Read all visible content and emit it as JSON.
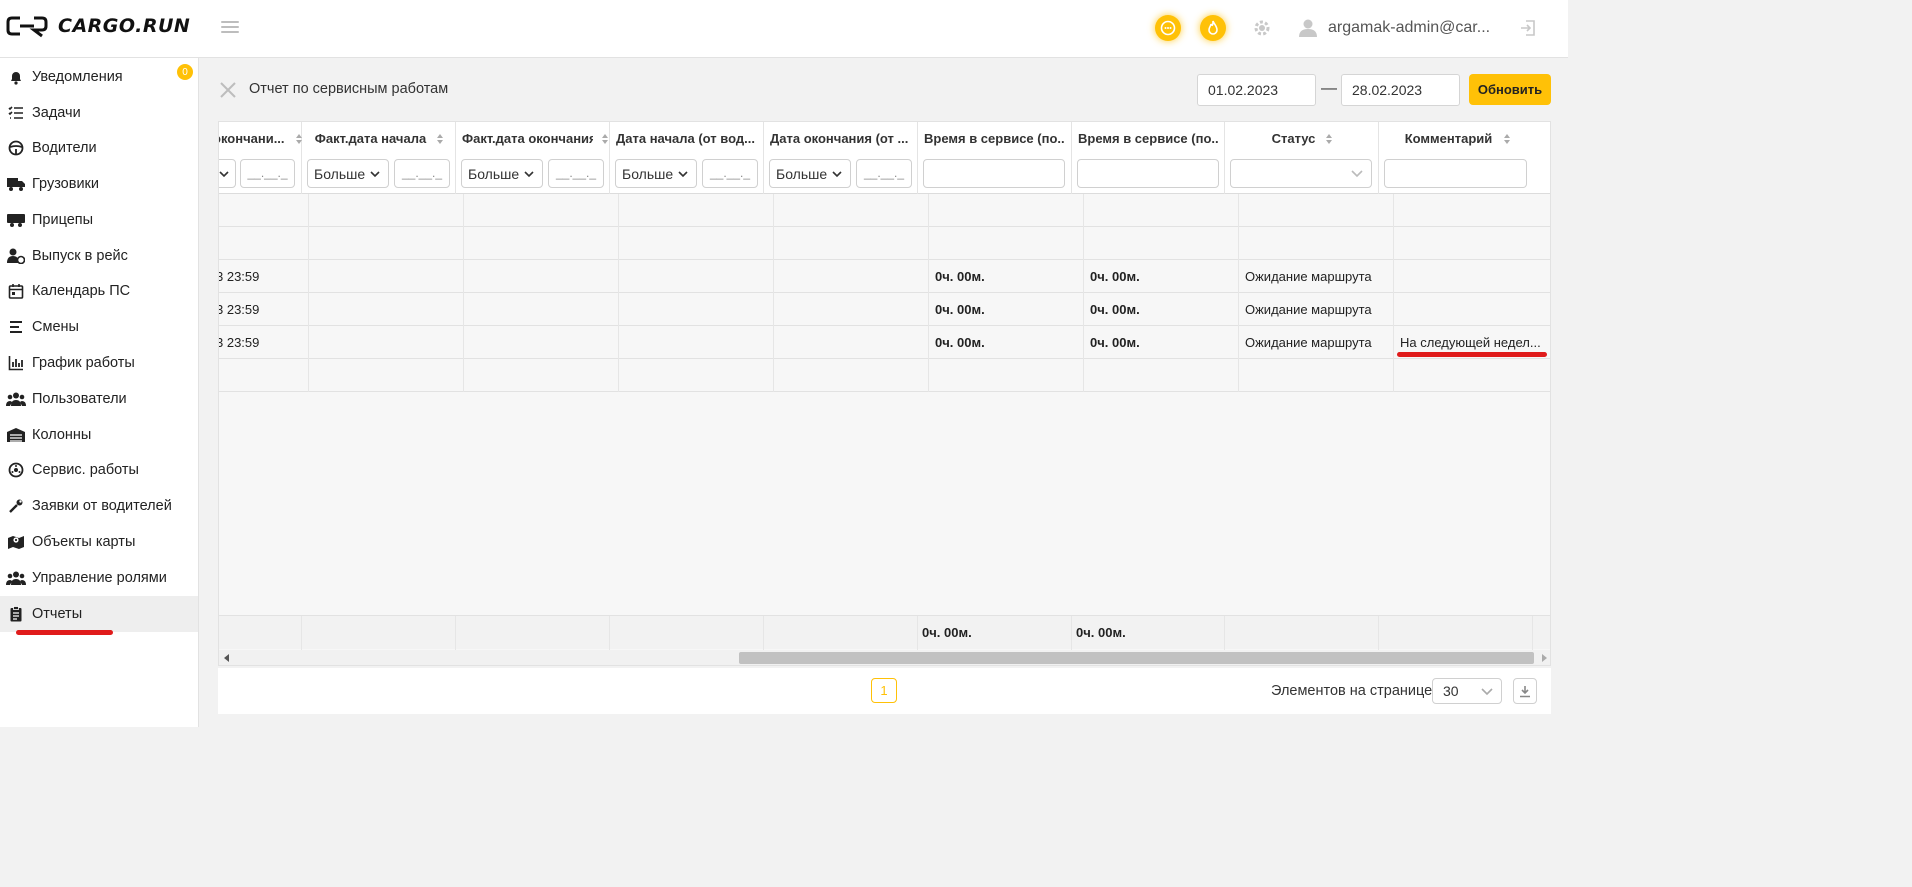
{
  "header": {
    "logo_text": "CARGO.RUN",
    "user_name": "argamak-admin@car...",
    "accent_color": "#ffc107"
  },
  "sidebar": {
    "items": [
      {
        "label": "Уведомления",
        "icon": "bell-icon",
        "badge": "0"
      },
      {
        "label": "Задачи",
        "icon": "task-list-icon"
      },
      {
        "label": "Водители",
        "icon": "steering-wheel-icon"
      },
      {
        "label": "Грузовики",
        "icon": "truck-icon"
      },
      {
        "label": "Прицепы",
        "icon": "trailer-icon"
      },
      {
        "label": "Выпуск в рейс",
        "icon": "user-check-icon"
      },
      {
        "label": "Календарь ПС",
        "icon": "calendar-icon"
      },
      {
        "label": "Смены",
        "icon": "shifts-icon"
      },
      {
        "label": "График работы",
        "icon": "chart-icon"
      },
      {
        "label": "Пользователи",
        "icon": "users-icon"
      },
      {
        "label": "Колонны",
        "icon": "warehouse-icon"
      },
      {
        "label": "Сервис. работы",
        "icon": "wheel-icon"
      },
      {
        "label": "Заявки от водителей",
        "icon": "wrench-icon"
      },
      {
        "label": "Объекты карты",
        "icon": "map-icon"
      },
      {
        "label": "Управление ролями",
        "icon": "roles-icon"
      },
      {
        "label": "Отчеты",
        "icon": "report-icon",
        "active": true
      }
    ]
  },
  "report": {
    "title": "Отчет по сервисным работам",
    "date_from": "01.02.2023",
    "date_to": "28.02.2023",
    "date_separator": "—",
    "refresh_label": "Обновить"
  },
  "grid": {
    "columns": [
      {
        "label": "окончани..."
      },
      {
        "label": "Факт.дата начала"
      },
      {
        "label": "Факт.дата окончания"
      },
      {
        "label": "Дата начала (от вод..."
      },
      {
        "label": "Дата окончания (от ..."
      },
      {
        "label": "Время в сервисе (по..."
      },
      {
        "label": "Время в сервисе (по..."
      },
      {
        "label": "Статус"
      },
      {
        "label": "Комментарий"
      }
    ],
    "filter_select_label": "Больше",
    "filter_date_placeholder": "__.__._",
    "rows": [
      [
        "",
        "",
        "",
        "",
        "",
        "",
        "",
        "",
        ""
      ],
      [
        "",
        "",
        "",
        "",
        "",
        "",
        "",
        "",
        ""
      ],
      [
        "3 23:59",
        "",
        "",
        "",
        "",
        "0ч. 00м.",
        "0ч. 00м.",
        "Ожидание маршрута",
        ""
      ],
      [
        "3 23:59",
        "",
        "",
        "",
        "",
        "0ч. 00м.",
        "0ч. 00м.",
        "Ожидание маршрута",
        ""
      ],
      [
        "3 23:59",
        "",
        "",
        "",
        "",
        "0ч. 00м.",
        "0ч. 00м.",
        "Ожидание маршрута",
        "На следующей недел..."
      ],
      [
        "",
        "",
        "",
        "",
        "",
        "",
        "",
        "",
        ""
      ]
    ],
    "summary": [
      "",
      "",
      "",
      "",
      "",
      "0ч. 00м.",
      "0ч. 00м.",
      "",
      ""
    ]
  },
  "footer": {
    "current_page": "1",
    "per_page_label": "Элементов на странице",
    "per_page_value": "30"
  }
}
